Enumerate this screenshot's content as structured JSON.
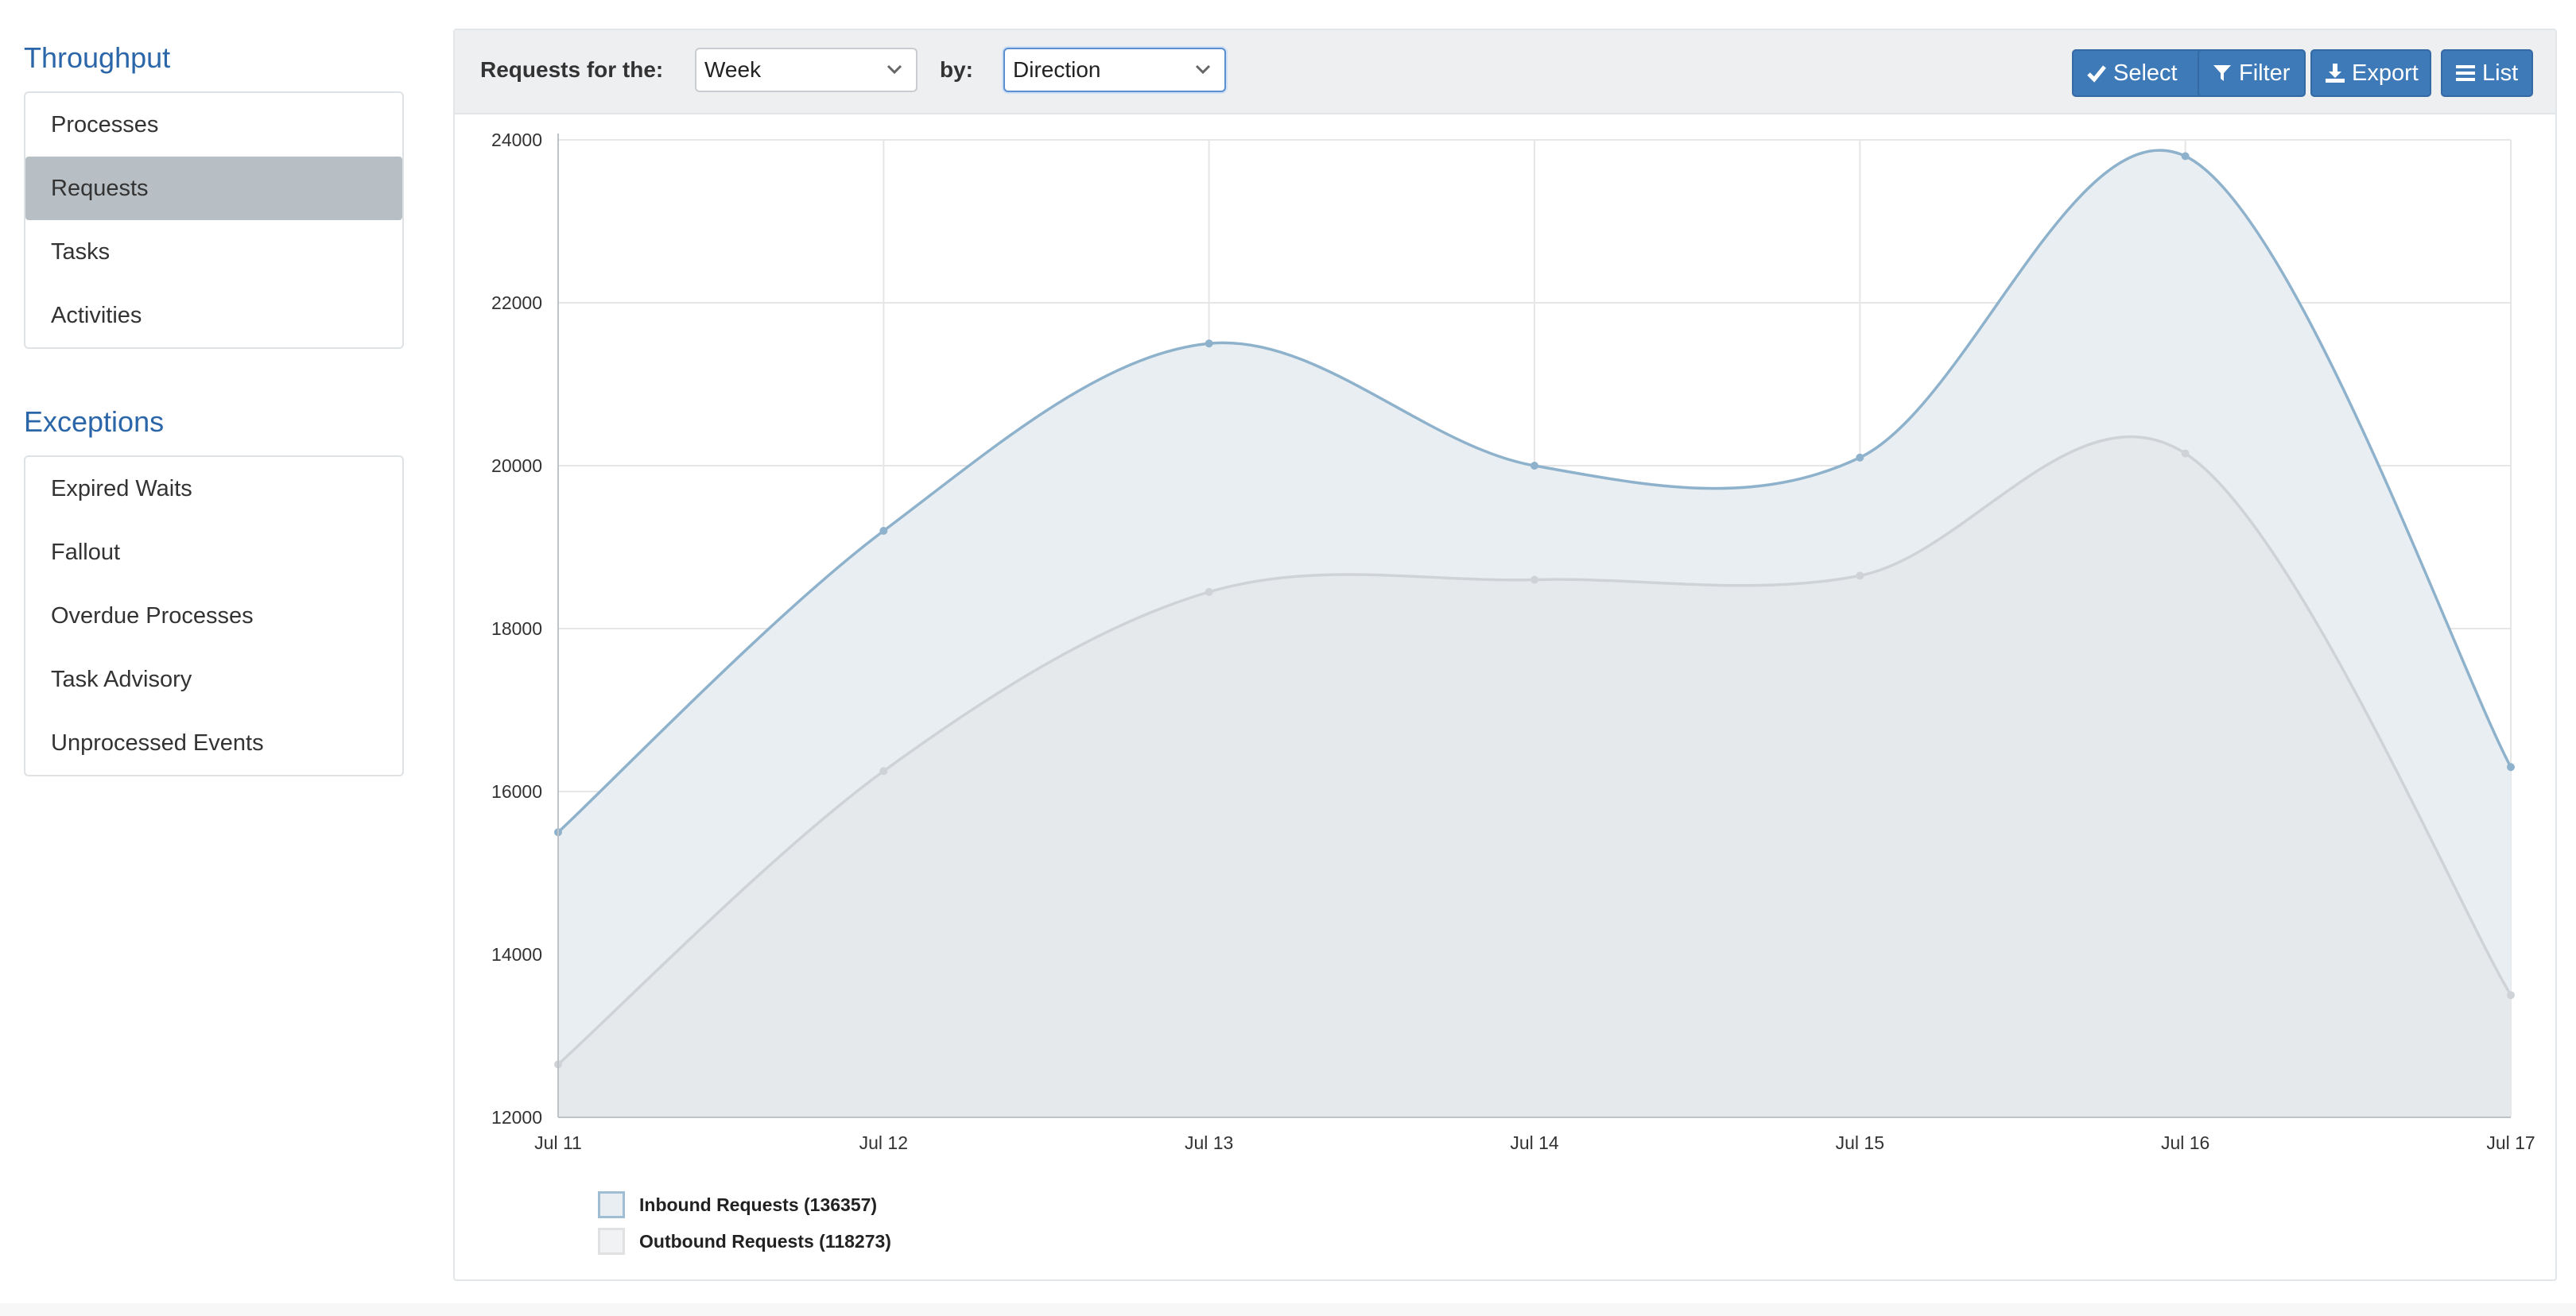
{
  "sidebar": {
    "throughput": {
      "heading": "Throughput",
      "items": [
        {
          "label": "Processes"
        },
        {
          "label": "Requests",
          "active": true
        },
        {
          "label": "Tasks"
        },
        {
          "label": "Activities"
        }
      ]
    },
    "exceptions": {
      "heading": "Exceptions",
      "items": [
        {
          "label": "Expired Waits"
        },
        {
          "label": "Fallout"
        },
        {
          "label": "Overdue Processes"
        },
        {
          "label": "Task Advisory"
        },
        {
          "label": "Unprocessed Events"
        }
      ]
    }
  },
  "toolbar": {
    "period_label": "Requests for the:",
    "period_value": "Week",
    "by_label": "by:",
    "by_value": "Direction",
    "buttons": {
      "select": "Select",
      "filter": "Filter",
      "export": "Export",
      "list": "List"
    }
  },
  "colors": {
    "accent": "#3e7ab8",
    "inbound_line": "#8fb2cc",
    "inbound_fill": "#e9eef2",
    "outbound_line": "#cfd3d7",
    "outbound_fill": "#e4e7ea"
  },
  "chart_data": {
    "type": "area",
    "categories": [
      "Jul 11",
      "Jul 12",
      "Jul 13",
      "Jul 14",
      "Jul 15",
      "Jul 16",
      "Jul 17"
    ],
    "series": [
      {
        "name": "Inbound Requests (136357)",
        "values": [
          15500,
          19200,
          21500,
          20000,
          20100,
          23800,
          16300
        ]
      },
      {
        "name": "Outbound Requests (118273)",
        "values": [
          12650,
          16250,
          18450,
          18600,
          18650,
          20150,
          13500
        ]
      }
    ],
    "ylim": [
      12000,
      24000
    ],
    "yticks": [
      12000,
      14000,
      16000,
      18000,
      20000,
      22000,
      24000
    ],
    "grid": true,
    "legend_position": "bottom-left"
  }
}
